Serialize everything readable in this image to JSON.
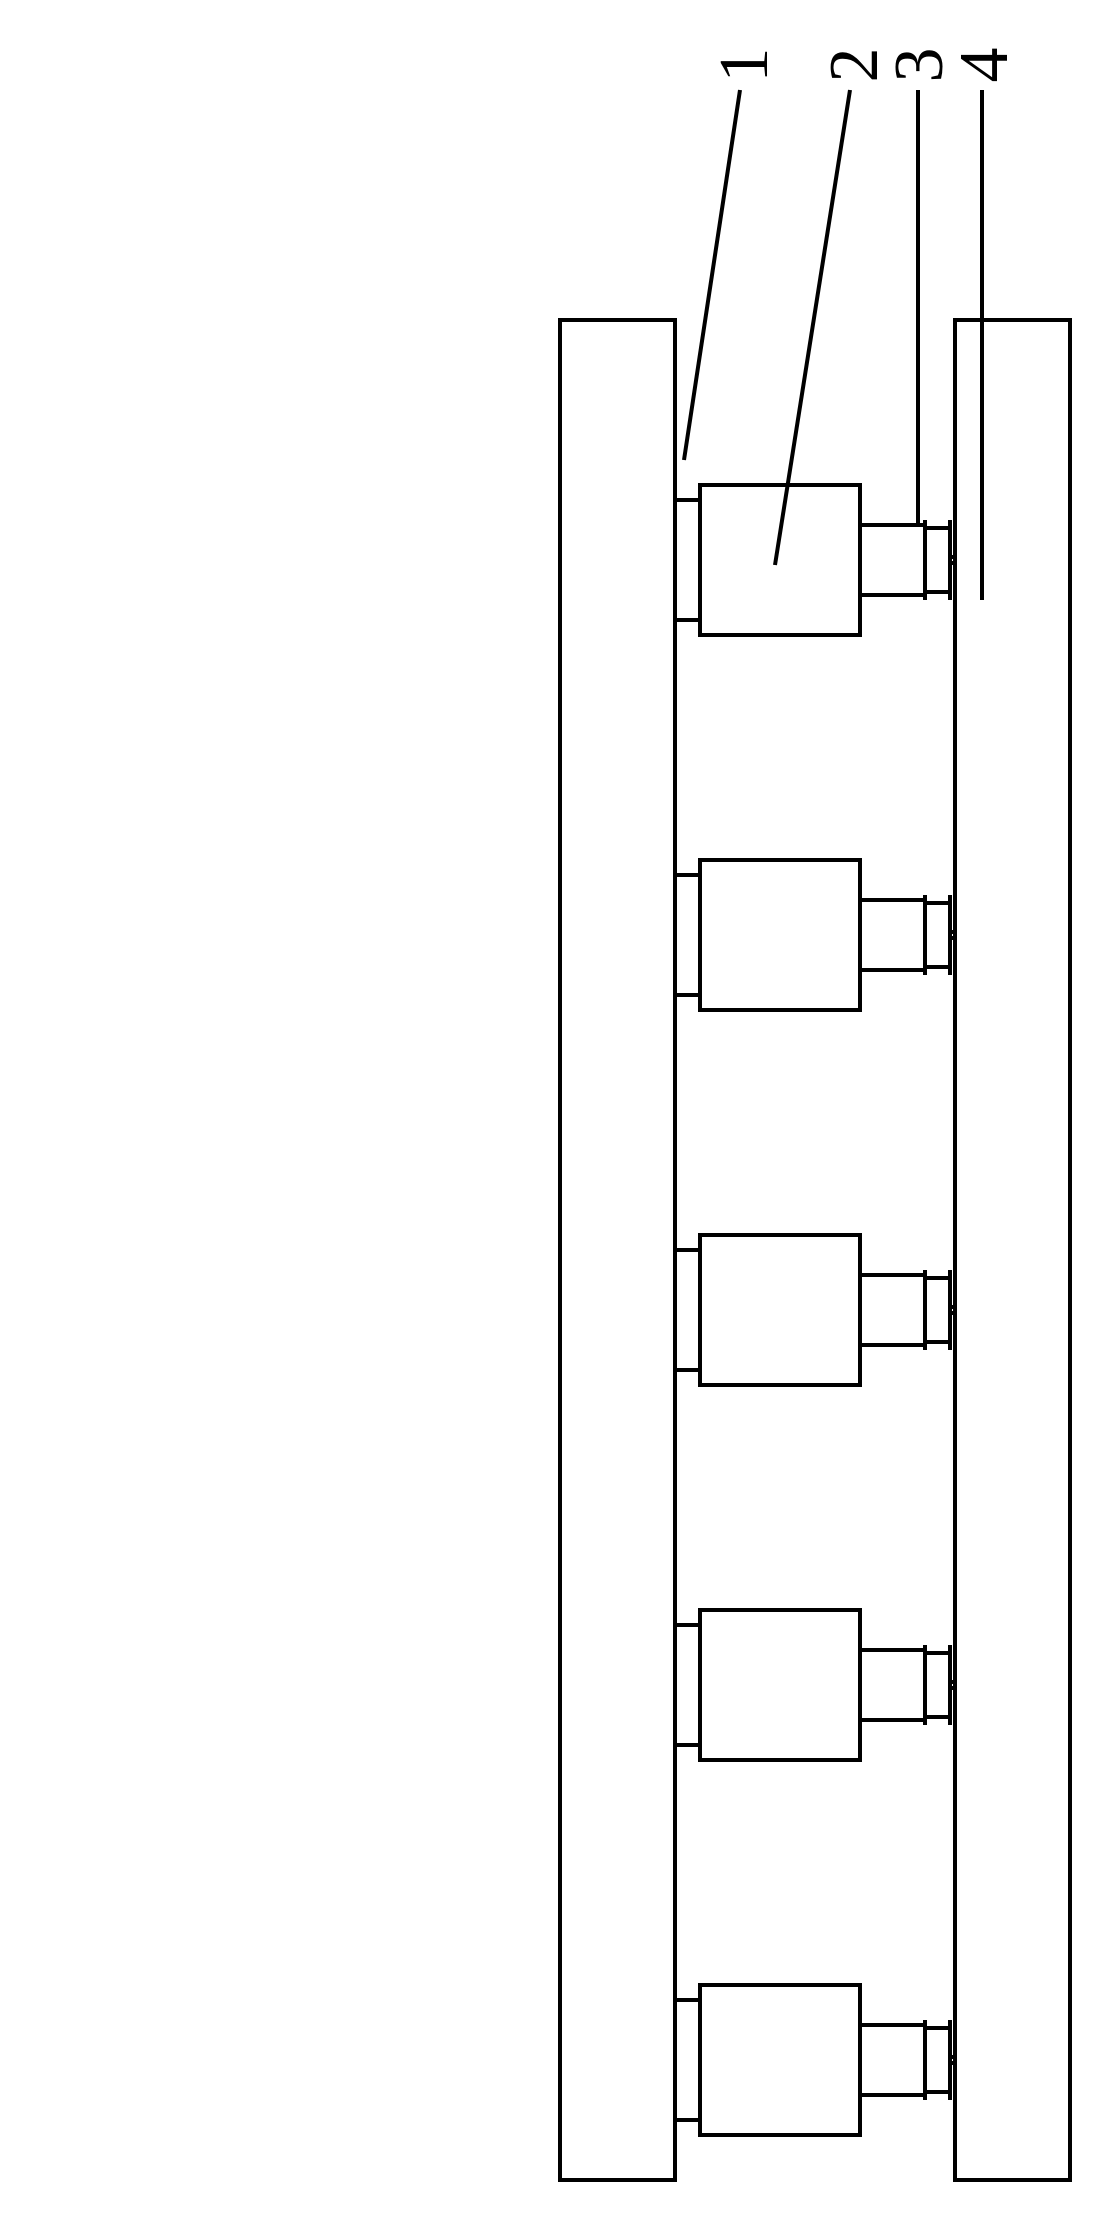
{
  "labels": {
    "l1": "1",
    "l2": "2",
    "l3": "3",
    "l4": "4"
  },
  "diagram": {
    "label_1_target": "top beam upper edge area",
    "label_2_target": "actuator body (cylinder)",
    "label_3_target": "actuator rod end / bracket",
    "label_4_target": "bottom beam",
    "num_actuators": 5
  }
}
